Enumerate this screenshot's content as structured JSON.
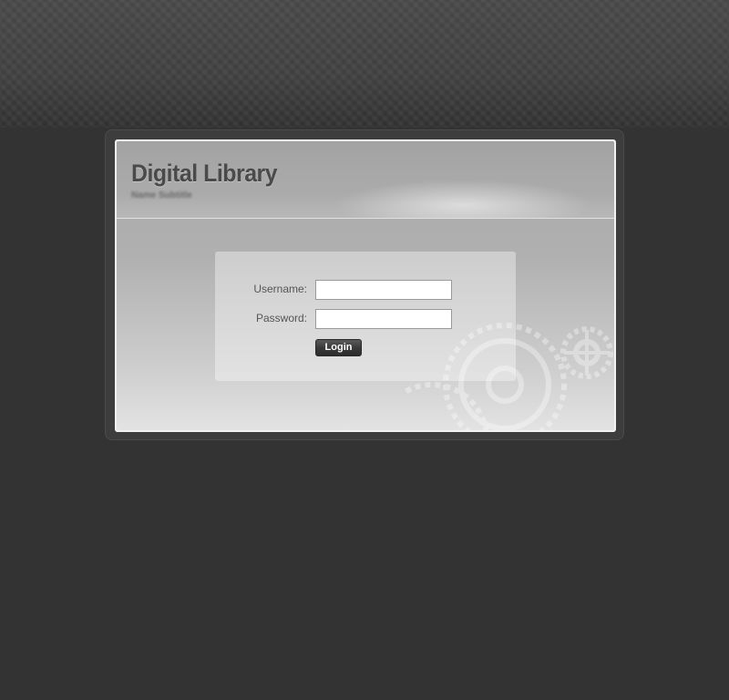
{
  "app": {
    "title": "Digital Library",
    "subtitle": "Name Subtitle"
  },
  "login_form": {
    "username_label": "Username:",
    "username_value": "",
    "password_label": "Password:",
    "password_value": "",
    "login_button_label": "Login"
  },
  "colors": {
    "page_background": "#333333",
    "panel_background": "#b0b0b0",
    "title_text": "#4a4a4a",
    "button_background": "#3a3a3a",
    "button_text": "#ffffff"
  },
  "icons": {
    "decoration": "gears-icon"
  }
}
